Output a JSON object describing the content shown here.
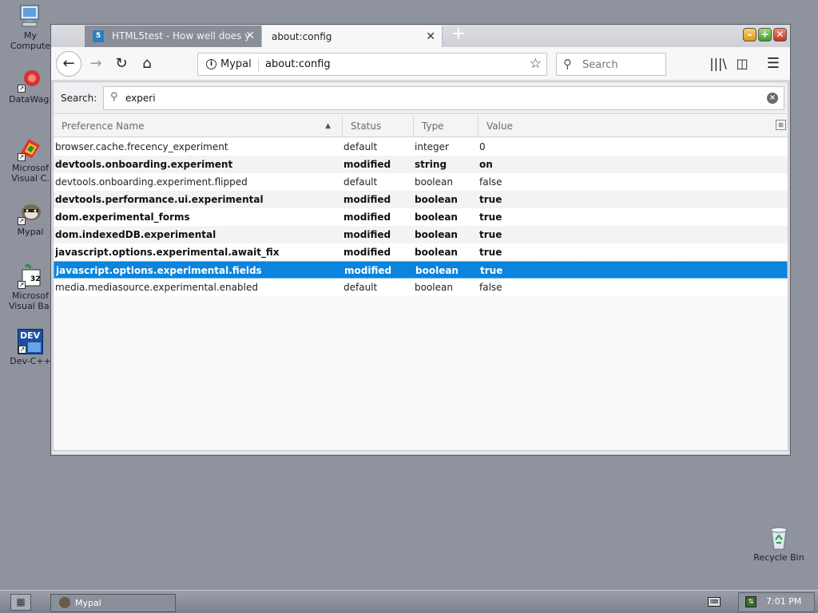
{
  "desktop": {
    "icons": [
      {
        "label_lines": [
          "My",
          "Compute"
        ]
      },
      {
        "label_lines": [
          "DataWag."
        ]
      },
      {
        "label_lines": [
          "Microsof",
          "Visual C."
        ]
      },
      {
        "label_lines": [
          "Mypal"
        ]
      },
      {
        "label_lines": [
          "Microsof",
          "Visual Ba."
        ]
      },
      {
        "label_lines": [
          "Dev-C++"
        ]
      },
      {
        "label_lines": [
          "Recycle Bin"
        ]
      }
    ],
    "dev_icon_text": "DEV",
    "vb_icon_text": "32"
  },
  "browser": {
    "tabs": [
      {
        "title": "HTML5test - How well does y",
        "favicon_text": "5"
      },
      {
        "title": "about:config"
      }
    ],
    "close_glyph": "✕",
    "new_tab_glyph": "+",
    "window_buttons": {
      "min": "–",
      "max": "+",
      "close": "✕"
    },
    "nav": {
      "back": "←",
      "forward": "→",
      "reload": "↻",
      "home": "⌂"
    },
    "urlbar": {
      "info": "i",
      "identity": "Mypal",
      "url": "about:config",
      "star": "☆"
    },
    "searchbar": {
      "placeholder": "Search",
      "icon": "⚲"
    },
    "toolbar": {
      "library": "|||\\",
      "sidebar": "◫",
      "menu": "☰"
    }
  },
  "config": {
    "search_label": "Search:",
    "search_value": "experi",
    "search_icon": "⚲",
    "clear_glyph": "×",
    "columns": [
      "Preference Name",
      "Status",
      "Type",
      "Value"
    ],
    "sort_glyph": "▲",
    "column_picker_glyph": "⊞",
    "rows": [
      {
        "name": "browser.cache.frecency_experiment",
        "status": "default",
        "type": "integer",
        "value": "0"
      },
      {
        "name": "devtools.onboarding.experiment",
        "status": "modified",
        "type": "string",
        "value": "on"
      },
      {
        "name": "devtools.onboarding.experiment.flipped",
        "status": "default",
        "type": "boolean",
        "value": "false"
      },
      {
        "name": "devtools.performance.ui.experimental",
        "status": "modified",
        "type": "boolean",
        "value": "true"
      },
      {
        "name": "dom.experimental_forms",
        "status": "modified",
        "type": "boolean",
        "value": "true"
      },
      {
        "name": "dom.indexedDB.experimental",
        "status": "modified",
        "type": "boolean",
        "value": "true"
      },
      {
        "name": "javascript.options.experimental.await_fix",
        "status": "modified",
        "type": "boolean",
        "value": "true"
      },
      {
        "name": "javascript.options.experimental.fields",
        "status": "modified",
        "type": "boolean",
        "value": "true",
        "selected": true
      },
      {
        "name": "media.mediasource.experimental.enabled",
        "status": "default",
        "type": "boolean",
        "value": "false"
      }
    ]
  },
  "taskbar": {
    "start_glyph": "▦",
    "task_label": "Mypal",
    "kbd_glyph": "⌨",
    "clock": "7:01 PM"
  }
}
